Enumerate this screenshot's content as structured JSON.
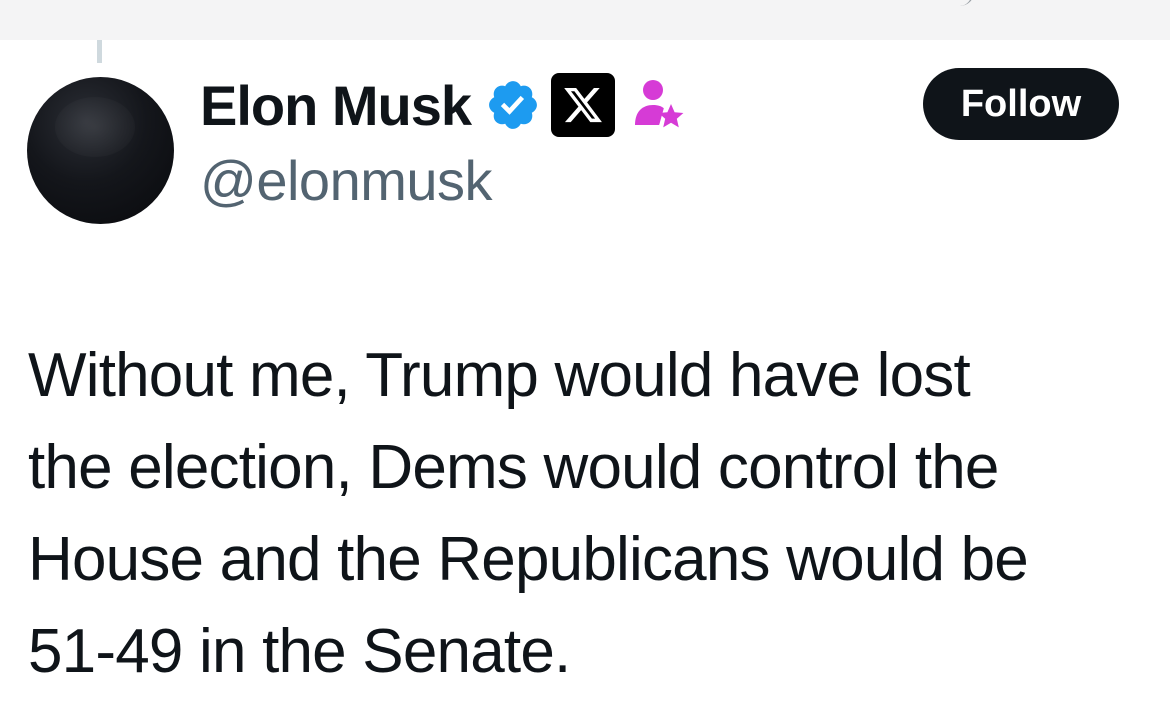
{
  "tweet": {
    "author": {
      "display_name": "Elon Musk",
      "handle": "@elonmusk",
      "badges": [
        "verified-checkmark-icon",
        "x-affiliate-badge-icon",
        "affiliate-person-star-icon"
      ]
    },
    "follow_button_label": "Follow",
    "text": "Without me, Trump would have lost\nthe election, Dems would control the\nHouse and the Republicans would be\n51-49 in the Senate."
  },
  "colors": {
    "text_primary": "#0f1419",
    "text_secondary": "#536471",
    "verified_blue": "#1d9bf0",
    "affiliate_magenta": "#d63bd6",
    "follow_bg": "#0f1419"
  }
}
